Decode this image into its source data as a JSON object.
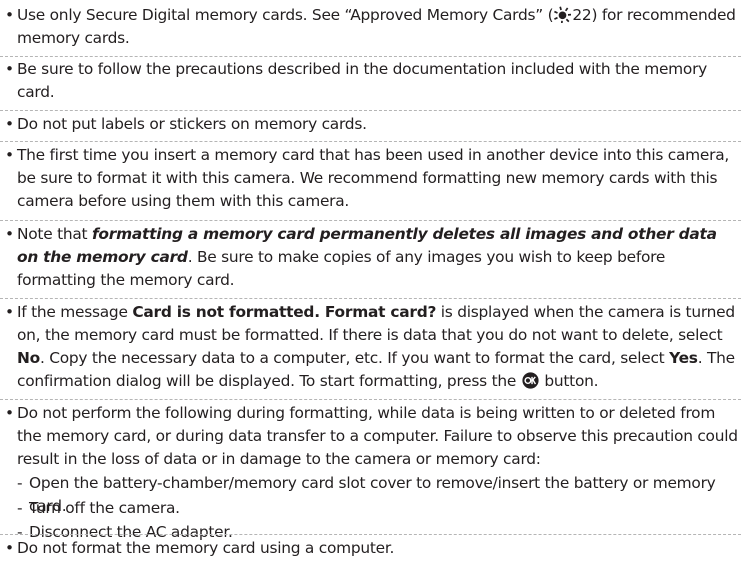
{
  "items": [
    {
      "pre": "Use only Secure Digital memory cards. See “Approved Memory Cards” (",
      "ref": "22",
      "post": ") for recommended memory cards."
    },
    {
      "text": "Be sure to follow the precautions described in the documentation included with the memory card."
    },
    {
      "text": "Do not put labels or stickers on memory cards."
    },
    {
      "text": "The first time you insert a memory card that has been used in another device into this camera, be sure to format it with this camera. We recommend formatting new memory cards with this camera before using them with this camera."
    },
    {
      "pre": "Note that ",
      "emph": "formatting a memory card permanently deletes all images and other data on the memory card",
      "post": ". Be sure to make copies of any images you wish to keep before formatting the memory card."
    },
    {
      "a": "If the message ",
      "msg": "Card is not formatted. Format card?",
      "b": " is displayed when the camera is turned on, the memory card must be formatted. If there is data that you do not want to delete, select ",
      "no": "No",
      "c": ". Copy the necessary data to a computer, etc. If you want to format the card, select ",
      "yes": "Yes",
      "d": ". The confirmation dialog will be displayed. To start formatting, press the ",
      "e": " button."
    },
    {
      "text": "Do not perform the following during formatting, while data is being written to or deleted from the memory card, or during data transfer to a computer. Failure to observe this precaution could result in the loss of data or in damage to the camera or memory card:"
    },
    {
      "text": "Do not format the memory card using a computer."
    }
  ],
  "subitems": [
    {
      "text": "Open the battery-chamber/memory card slot cover to remove/insert the battery or memory card."
    },
    {
      "text": "Turn off the camera."
    },
    {
      "text": "Disconnect the AC adapter."
    }
  ],
  "glyphs": {
    "bullet": "•",
    "dash": "-"
  },
  "icons": {
    "reference": "reference-sun-icon",
    "ok": "ok-button-icon"
  }
}
